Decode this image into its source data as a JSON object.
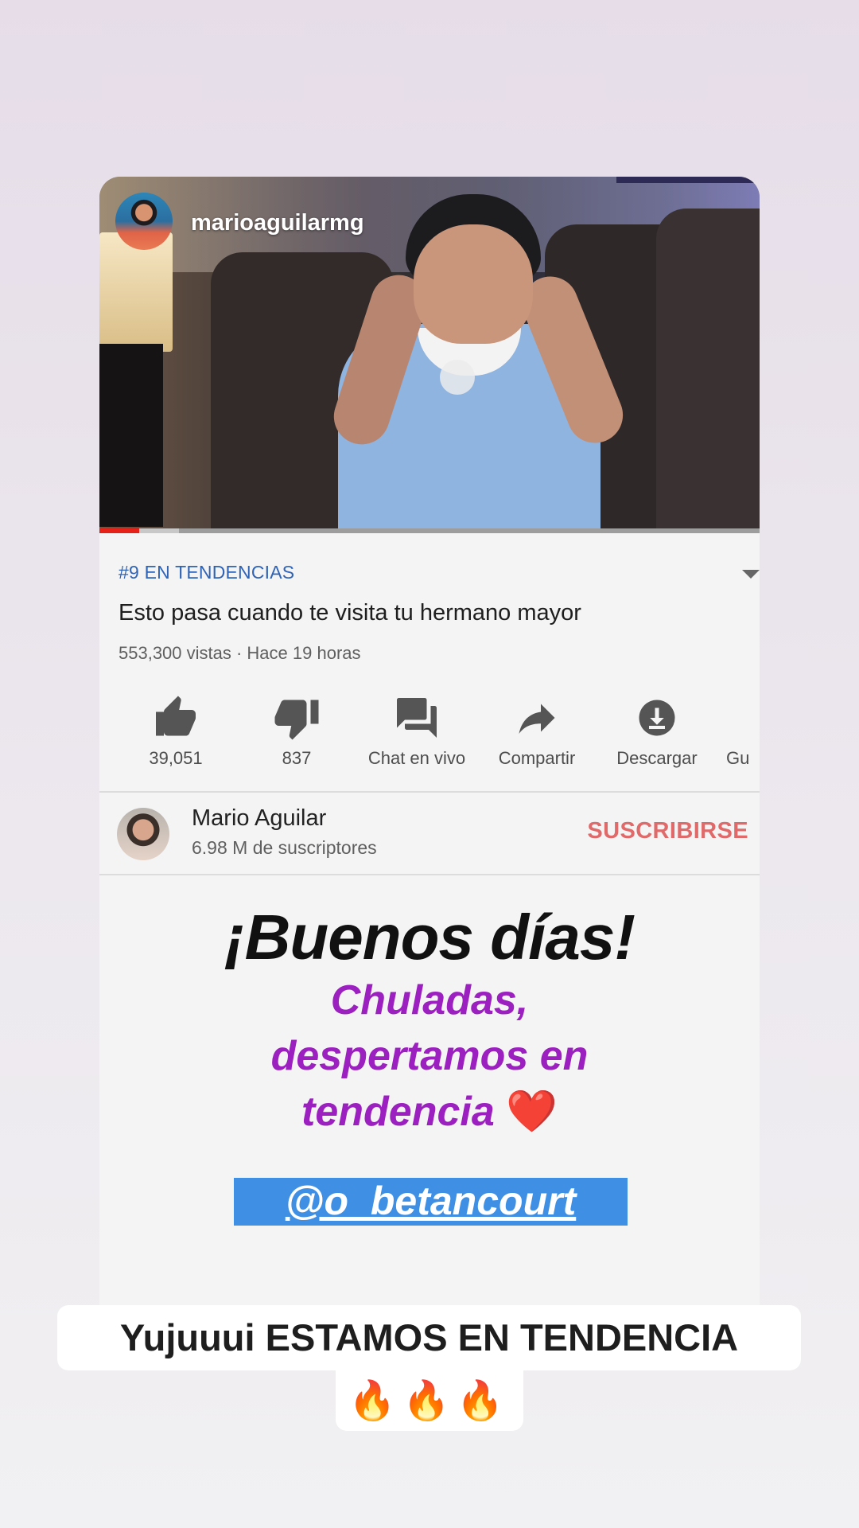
{
  "story": {
    "username": "marioaguilarmg"
  },
  "video": {
    "progress_fraction": 0.06,
    "buffered_fraction": 0.12,
    "trending": "#9 EN TENDENCIAS",
    "title": "Esto pasa cuando te visita tu hermano mayor",
    "meta": "553,300 vistas · Hace 19 horas"
  },
  "actions": [
    {
      "icon": "thumbs-up-icon",
      "label": "39,051"
    },
    {
      "icon": "thumbs-down-icon",
      "label": "837"
    },
    {
      "icon": "live-chat-icon",
      "label": "Chat en vivo"
    },
    {
      "icon": "share-icon",
      "label": "Compartir"
    },
    {
      "icon": "download-icon",
      "label": "Descargar"
    },
    {
      "icon": "save-icon",
      "label": "Gu"
    }
  ],
  "channel": {
    "name": "Mario Aguilar",
    "subscribers": "6.98 M de suscriptores",
    "subscribe_label": "SUSCRIBIRSE"
  },
  "overlay": {
    "greeting": "¡Buenos días!",
    "line1": "Chuladas,",
    "line2": "despertamos en",
    "line3": "tendencia",
    "heart": "❤️",
    "mention": "@o_betancourt"
  },
  "caption": {
    "line1": "Yujuuui ESTAMOS EN TENDENCIA",
    "line2": "🔥🔥🔥"
  },
  "colors": {
    "trending": "#2e63b6",
    "subscribe": "#e06a6a",
    "purple_text": "#9c1fc0",
    "mention_bg": "#3f90e4",
    "progress": "#e62117"
  }
}
